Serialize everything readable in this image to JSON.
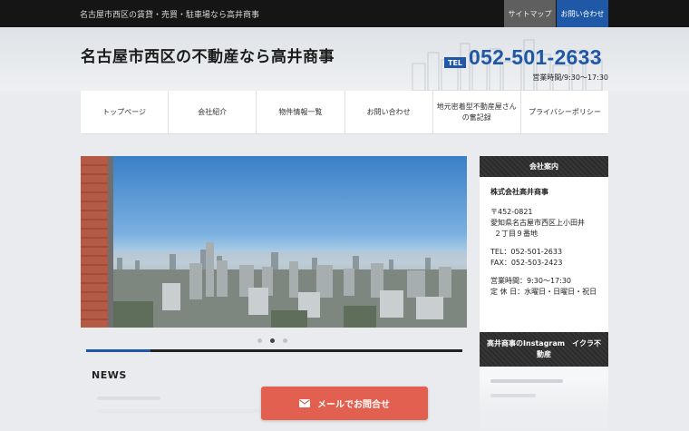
{
  "topbar": {
    "tagline": "名古屋市西区の賃貸・売買・駐車場なら高井商事",
    "sitemap_label": "サイトマップ",
    "contact_label": "お問い合わせ"
  },
  "header": {
    "title": "名古屋市西区の不動産なら高井商事",
    "tel_badge": "TEL",
    "tel_number": "052-501-2633",
    "hours": "営業時間/9:30〜17:30"
  },
  "nav": {
    "items": [
      {
        "label": "トップページ"
      },
      {
        "label": "会社紹介"
      },
      {
        "label": "物件情報一覧"
      },
      {
        "label": "お問い合わせ"
      },
      {
        "label": "地元密着型不動産屋さんの奮記録"
      },
      {
        "label": "プライバシーポリシー"
      }
    ]
  },
  "slider": {
    "dot_count": 3,
    "active_dot": 2,
    "progress": 0.17
  },
  "news": {
    "title": "NEWS"
  },
  "sidebar": {
    "company_heading": "会社案内",
    "company_name": "株式会社高井商事",
    "postal": "〒452-0821",
    "address1": "愛知県名古屋市西区上小田井",
    "address2": "２丁目９番地",
    "tel": "TEL：052-501-2633",
    "fax": "FAX：052-503-2423",
    "hours": "営業時間：9:30〜17:30",
    "holiday": "定 休 日：水曜日・日曜日・祝日",
    "instagram_heading": "高井商事のInstagram　イクラ不動産"
  },
  "mail_button": {
    "label": "メールでお問合せ",
    "icon": "envelope-icon"
  },
  "colors": {
    "brand_blue": "#1f58a6",
    "mail_button": "#e2604f",
    "topbar": "#151515"
  }
}
